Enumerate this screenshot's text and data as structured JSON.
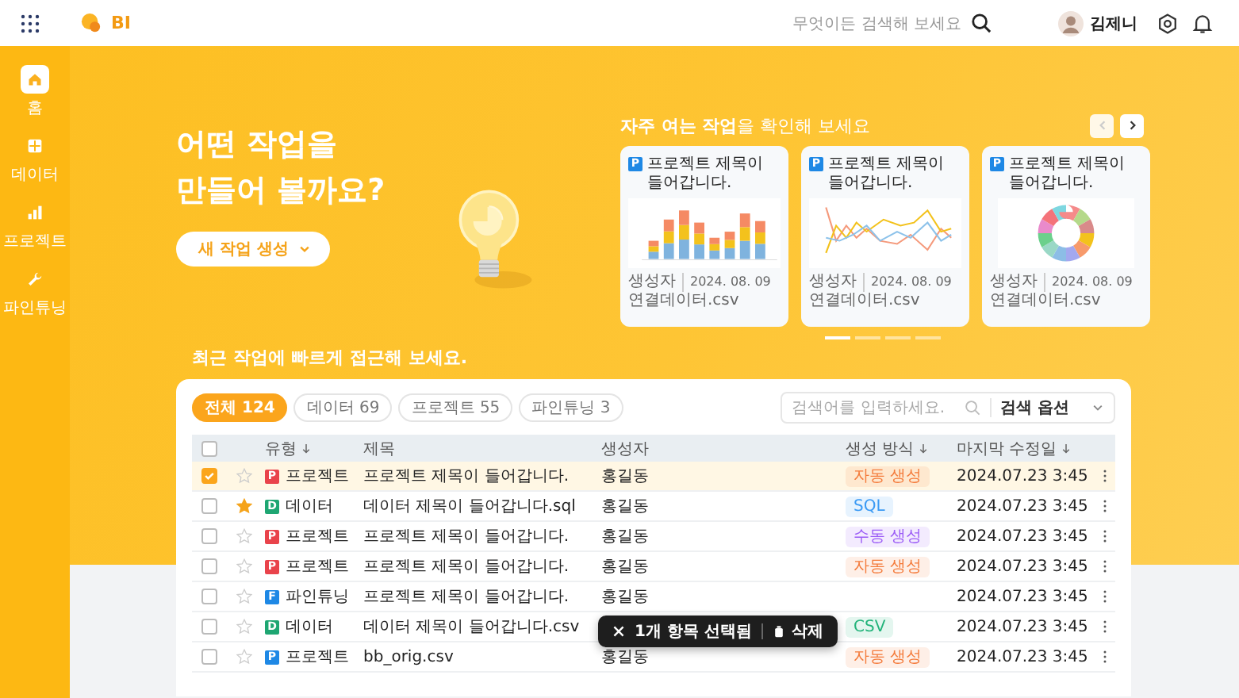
{
  "topbar": {
    "logo": "BI",
    "search": {
      "placeholder": "무엇이든 검색해 보세요"
    },
    "user": {
      "name": "김제니"
    }
  },
  "sidebar": {
    "items": [
      {
        "kind": "home",
        "label": "홈",
        "selected": true
      },
      {
        "kind": "grid",
        "label": "데이터",
        "selected": false
      },
      {
        "kind": "bars",
        "label": "프로젝트",
        "selected": false
      },
      {
        "kind": "wrench",
        "label": "파인튜닝",
        "selected": false
      }
    ]
  },
  "hero": {
    "title": "어떤 작업을\n만들어 볼까요?",
    "create_button": "새 작업 생성",
    "frequent": {
      "heading": "**자주 여는 작업**을 확인해 보세요",
      "prev_disabled": true,
      "cards": [
        {
          "kind": "bar",
          "icon_letter": "P",
          "title": "프로젝트 제목이 들어갑니다.",
          "creator": "생성자",
          "date": "2024. 08. 09",
          "file": "연결데이터.csv"
        },
        {
          "kind": "line",
          "icon_letter": "P",
          "title": "프로젝트 제목이 들어갑니다.",
          "creator": "생성자",
          "date": "2024. 08. 09",
          "file": "연결데이터.csv"
        },
        {
          "kind": "donut",
          "icon_letter": "P",
          "title": "프로젝트 제목이 들어갑니다.",
          "creator": "생성자",
          "date": "2024. 08. 09",
          "file": "연결데이터.csv"
        }
      ],
      "pager": [
        {
          "selected": true
        },
        {
          "selected": false
        },
        {
          "selected": false
        },
        {
          "selected": false
        }
      ]
    },
    "recent_heading": "최근 작업에 빠르게 접근해 보세요."
  },
  "table": {
    "filters": [
      {
        "label": "전체 124",
        "selected": true
      },
      {
        "label": "데이터 69",
        "selected": false
      },
      {
        "label": "프로젝트 55",
        "selected": false
      },
      {
        "label": "파인튜닝 3",
        "selected": false
      }
    ],
    "search": {
      "placeholder": "검색어를 입력하세요."
    },
    "search_options": "검색 옵션",
    "select_all_checked": false,
    "columns": [
      {
        "label": "유형",
        "sortable": true
      },
      {
        "label": "제목",
        "sortable": false
      },
      {
        "label": "생성자",
        "sortable": false
      },
      {
        "label": "생성 방식",
        "sortable": true
      },
      {
        "label": "마지막 수정일",
        "sortable": true
      }
    ],
    "rows": [
      {
        "checked": true,
        "starred": false,
        "type_letter": "P",
        "color": "#e9434b",
        "type": "프로젝트",
        "title": "프로젝트 제목이 들어갑니다.",
        "creator": "홍길동",
        "method": {
          "label": "자동 생성",
          "color": "#f47b3b"
        },
        "modified": "2024.07.23 3:45"
      },
      {
        "checked": false,
        "starred": true,
        "type_letter": "D",
        "color": "#1ea672",
        "type": "데이터",
        "title": "데이터 제목이 들어갑니다.sql",
        "creator": "홍길동",
        "method": {
          "label": "SQL",
          "color": "#3b9af4"
        },
        "modified": "2024.07.23 3:45"
      },
      {
        "checked": false,
        "starred": false,
        "type_letter": "P",
        "color": "#e9434b",
        "type": "프로젝트",
        "title": "프로젝트 제목이 들어갑니다.",
        "creator": "홍길동",
        "method": {
          "label": "수동 생성",
          "color": "#9b5cf6"
        },
        "modified": "2024.07.23 3:45"
      },
      {
        "checked": false,
        "starred": false,
        "type_letter": "P",
        "color": "#e9434b",
        "type": "프로젝트",
        "title": "프로젝트 제목이 들어갑니다.",
        "creator": "홍길동",
        "method": {
          "label": "자동 생성",
          "color": "#f47b3b"
        },
        "modified": "2024.07.23 3:45"
      },
      {
        "checked": false,
        "starred": false,
        "type_letter": "F",
        "color": "#1e88e5",
        "type": "파인튜닝",
        "title": "프로젝트 제목이 들어갑니다.",
        "creator": "홍길동",
        "modified": "2024.07.23 3:45"
      },
      {
        "checked": false,
        "starred": false,
        "type_letter": "D",
        "color": "#1ea672",
        "type": "데이터",
        "title": "데이터 제목이 들어갑니다.csv",
        "method": {
          "label": "CSV",
          "color": "#22b37a"
        },
        "modified": "2024.07.23 3:45"
      },
      {
        "checked": false,
        "starred": false,
        "type_letter": "P",
        "color": "#1e88e5",
        "type": "프로젝트",
        "title": "bb_orig.csv",
        "creator": "홍길동",
        "method": {
          "label": "자동 생성",
          "color": "#f47b3b"
        },
        "modified": "2024.07.23 3:45"
      }
    ],
    "selection_toast": {
      "count_label": "1개 항목 선택됨",
      "delete": "삭제"
    }
  }
}
